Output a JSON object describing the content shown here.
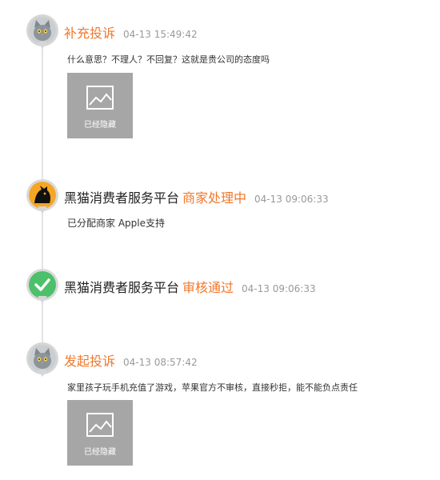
{
  "events": [
    {
      "type": "补充投诉",
      "time": "04-13 15:49:42",
      "content": "什么意思？不理人？不回复？这就是贵公司的态度吗",
      "attachment_label": "已经隐藏",
      "icon": "cat-avatar-icon"
    },
    {
      "actor": "黑猫消费者服务平台",
      "status": "商家处理中",
      "time": "04-13 09:06:33",
      "content": "已分配商家 Apple支持",
      "icon": "black-cat-logo-icon"
    },
    {
      "actor": "黑猫消费者服务平台",
      "status": "审核通过",
      "time": "04-13 09:06:33",
      "icon": "check-icon",
      "accent": "#4cc06a"
    },
    {
      "type": "发起投诉",
      "time": "04-13 08:57:42",
      "content": "家里孩子玩手机充值了游戏，苹果官方不审核，直接秒拒，能不能负点责任",
      "attachment_label": "已经隐藏",
      "icon": "cat-avatar-icon"
    }
  ],
  "colors": {
    "accent_orange": "#f0782c",
    "time_gray": "#999999",
    "thumb_gray": "#a6a6a6"
  }
}
